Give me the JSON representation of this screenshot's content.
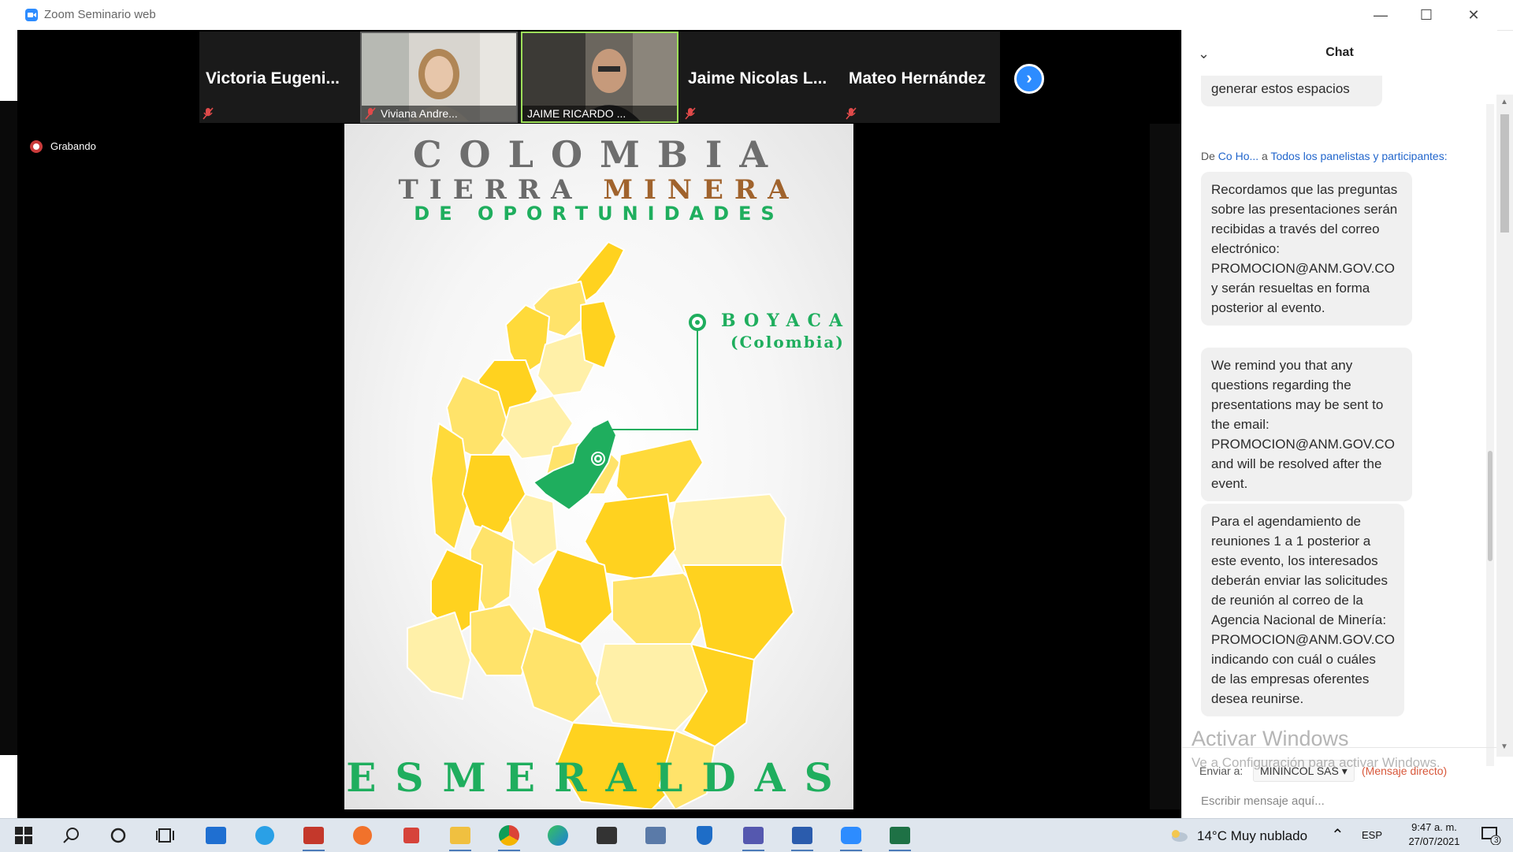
{
  "window": {
    "title": "Zoom Seminario web",
    "minimize_icon": "minimize-icon",
    "maximize_icon": "maximize-icon",
    "close_icon": "close-icon"
  },
  "participants": [
    {
      "name": "Victoria  Eugeni...",
      "type": "name",
      "muted": true
    },
    {
      "name": "Viviana Andre...",
      "type": "video",
      "muted": true
    },
    {
      "name": "JAIME RICARDO ...",
      "type": "video",
      "muted": false,
      "active": true
    },
    {
      "name": "Jaime  Nicolas  L...",
      "type": "name",
      "muted": true
    },
    {
      "name": "Mateo Hernández",
      "type": "name",
      "muted": true
    }
  ],
  "recording": {
    "label": "Grabando"
  },
  "slide": {
    "line1": "COLOMBIA",
    "line2a": "TIERRA",
    "line2b": "MINERA",
    "line3": "DE OPORTUNIDADES",
    "callout1": "BOYACA",
    "callout2": "(Colombia)",
    "bottom": "ESMERALDAS",
    "colors": {
      "green": "#1fae5e",
      "gray": "#6e6e6e",
      "brown": "#a0632d",
      "yellow": "#ffd21f",
      "pale": "#fff0a8"
    }
  },
  "chat": {
    "title": "Chat",
    "partial_message": "generar estos espacios",
    "sender_prefix": "De",
    "sender": "Co Ho...",
    "sender_to": "a",
    "recipient_group": "Todos los panelistas y participantes:",
    "messages": [
      "Recordamos que las preguntas sobre las presentaciones serán recibidas a través del correo electrónico: PROMOCION@ANM.GOV.CO y serán resueltas en forma posterior al evento.",
      "We remind you that any questions regarding the presentations may be sent to the email: PROMOCION@ANM.GOV.CO and will be resolved after the event.",
      "Para el agendamiento de reuniones 1 a 1 posterior a este evento, los interesados deberán enviar las solicitudes de reunión al correo de la Agencia Nacional de Minería: PROMOCION@ANM.GOV.CO indicando con cuál o cuáles de las empresas oferentes desea reunirse."
    ],
    "send_to_label": "Enviar a:",
    "send_to_value": "MININCOL SAS",
    "direct_label": "(Mensaje directo)",
    "input_placeholder": "Escribir mensaje aquí..."
  },
  "watermark": {
    "line1": "Activar Windows",
    "line2": "Ve a Configuración para activar Windows."
  },
  "taskbar": {
    "weather": "14°C  Muy nublado",
    "language": "ESP",
    "time": "9:47 a. m.",
    "date": "27/07/2021",
    "notifications": "3",
    "apps": [
      "start-icon",
      "search-icon",
      "cortana-icon",
      "task-view-icon",
      "mail-icon",
      "internet-explorer-icon",
      "powerpoint-icon",
      "firefox-icon",
      "gift-icon",
      "file-explorer-icon",
      "chrome-icon",
      "edge-icon",
      "store-icon",
      "network-tool-icon",
      "security-icon",
      "teams-icon",
      "word-icon",
      "zoom-icon",
      "excel-icon"
    ]
  }
}
